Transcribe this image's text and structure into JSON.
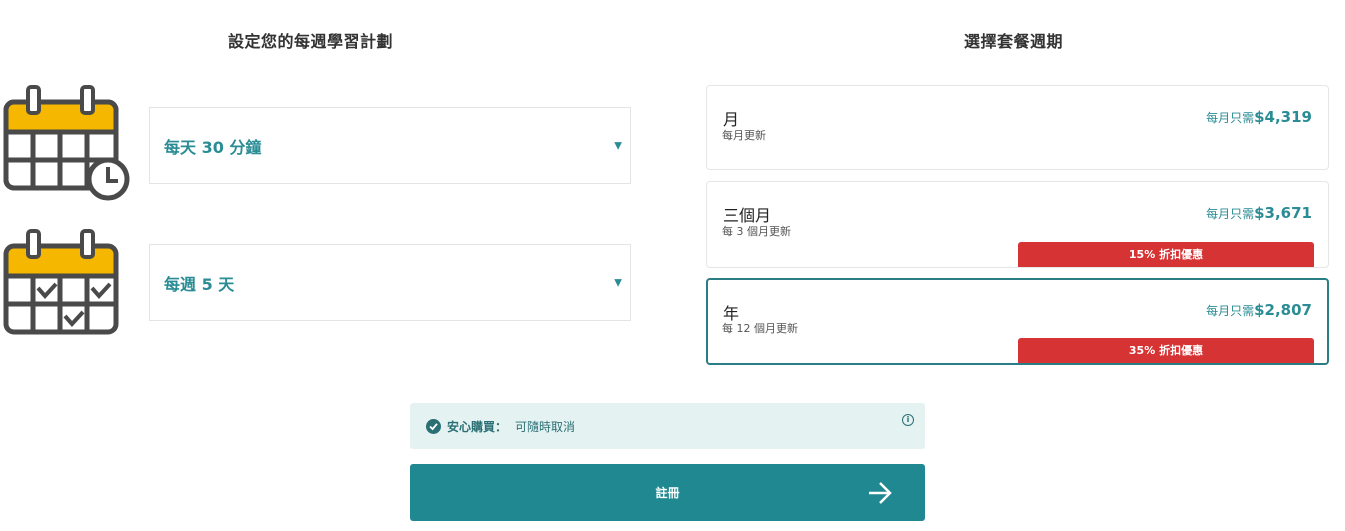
{
  "left": {
    "title": "設定您的每週學習計劃",
    "time_select": {
      "value": "每天 30 分鐘"
    },
    "days_select": {
      "value": "每週 5 天"
    }
  },
  "right": {
    "title": "選擇套餐週期",
    "plans": [
      {
        "name": "月",
        "sub": "每月更新",
        "price_prefix": "每月只需",
        "price": "$4,319",
        "badge": ""
      },
      {
        "name": "三個月",
        "sub": "每 3 個月更新",
        "price_prefix": "每月只需",
        "price": "$3,671",
        "badge": "15% 折扣優惠"
      },
      {
        "name": "年",
        "sub": "每 12 個月更新",
        "price_prefix": "每月只需",
        "price": "$2,807",
        "badge": "35% 折扣優惠",
        "selected": true
      }
    ]
  },
  "guarantee": {
    "label": "安心購買：",
    "text": "可隨時取消"
  },
  "signup": {
    "label": "註冊"
  },
  "colors": {
    "teal": "#208891",
    "teal_text": "#2a8c94",
    "badge_red": "#d63334",
    "calendar_yellow": "#f5b700",
    "calendar_gray": "#4a4a4a"
  },
  "icons": {
    "calendar_clock": "calendar-clock-icon",
    "calendar_check": "calendar-check-icon",
    "caret": "caret-down-icon",
    "check": "check-circle-icon",
    "info": "info-icon",
    "arrow": "arrow-right-icon"
  }
}
